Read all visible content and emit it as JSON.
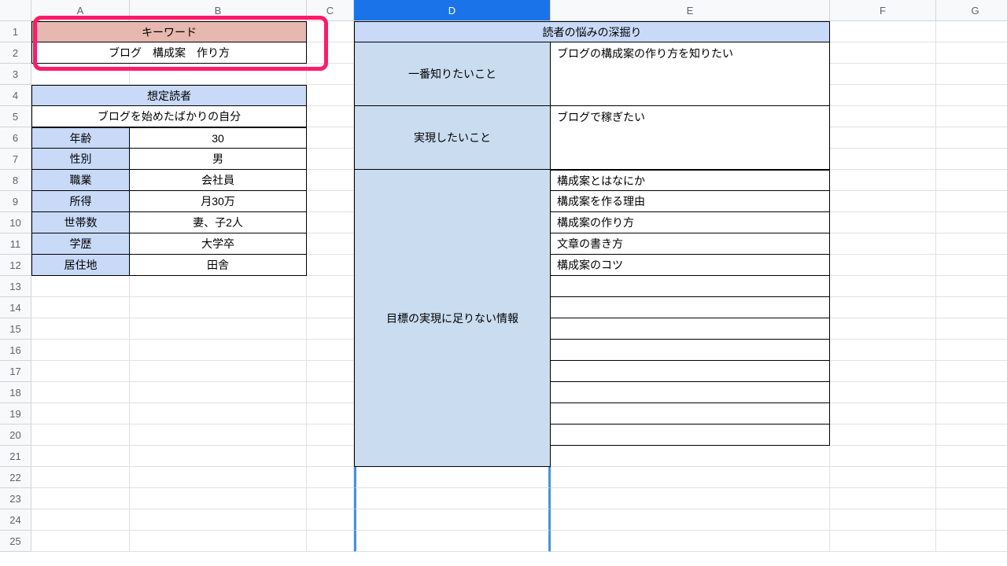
{
  "columns": [
    "A",
    "B",
    "C",
    "D",
    "E",
    "F",
    "G"
  ],
  "rows": [
    "1",
    "2",
    "3",
    "4",
    "5",
    "6",
    "7",
    "8",
    "9",
    "10",
    "11",
    "12",
    "13",
    "14",
    "15",
    "16",
    "17",
    "18",
    "19",
    "20",
    "21",
    "22",
    "23",
    "24",
    "25"
  ],
  "keyword": {
    "header": "キーワード",
    "value": "ブログ　構成案　作り方"
  },
  "reader_profile": {
    "header": "想定読者",
    "summary": "ブログを始めたばかりの自分",
    "rows": [
      {
        "label": "年齢",
        "value": "30"
      },
      {
        "label": "性別",
        "value": "男"
      },
      {
        "label": "職業",
        "value": "会社員"
      },
      {
        "label": "所得",
        "value": "月30万"
      },
      {
        "label": "世帯数",
        "value": "妻、子2人"
      },
      {
        "label": "学歴",
        "value": "大学卒"
      },
      {
        "label": "居住地",
        "value": "田舎"
      }
    ]
  },
  "reader_needs": {
    "header": "読者の悩みの深掘り",
    "sections": [
      {
        "label": "一番知りたいこと",
        "value": "ブログの構成案の作り方を知りたい"
      },
      {
        "label": "実現したいこと",
        "value": "ブログで稼ぎたい"
      }
    ],
    "missing_label": "目標の実現に足りない情報",
    "missing_info": [
      "構成案とはなにか",
      "構成案を作る理由",
      "構成案の作り方",
      "文章の書き方",
      "構成案のコツ",
      "",
      "",
      "",
      "",
      "",
      "",
      "",
      ""
    ]
  }
}
